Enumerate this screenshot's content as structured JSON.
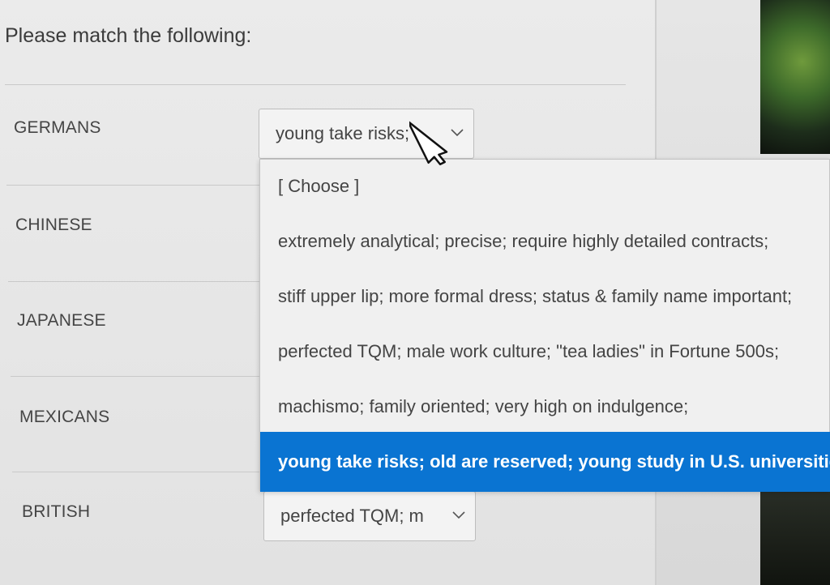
{
  "question": "Please match the following:",
  "rows": [
    {
      "term": "GERMANS",
      "selected": "young take risks;"
    },
    {
      "term": "CHINESE"
    },
    {
      "term": "JAPANESE"
    },
    {
      "term": "MEXICANS"
    },
    {
      "term": "BRITISH",
      "selected": "perfected TQM; m"
    }
  ],
  "dropdown": {
    "options": [
      "[ Choose ]",
      "extremely analytical; precise; require highly detailed contracts;",
      "stiff upper lip; more formal dress; status & family name important;",
      "perfected TQM; male work culture; \"tea ladies\" in Fortune 500s;",
      "machismo; family oriented; very high on indulgence;",
      "young take risks; old are reserved; young study in U.S. universities"
    ],
    "highlighted_index": 5,
    "highlight_color": "#0a74d2"
  },
  "icons": {
    "chevron": "chevron-down-icon",
    "cursor": "mouse-pointer-icon"
  }
}
